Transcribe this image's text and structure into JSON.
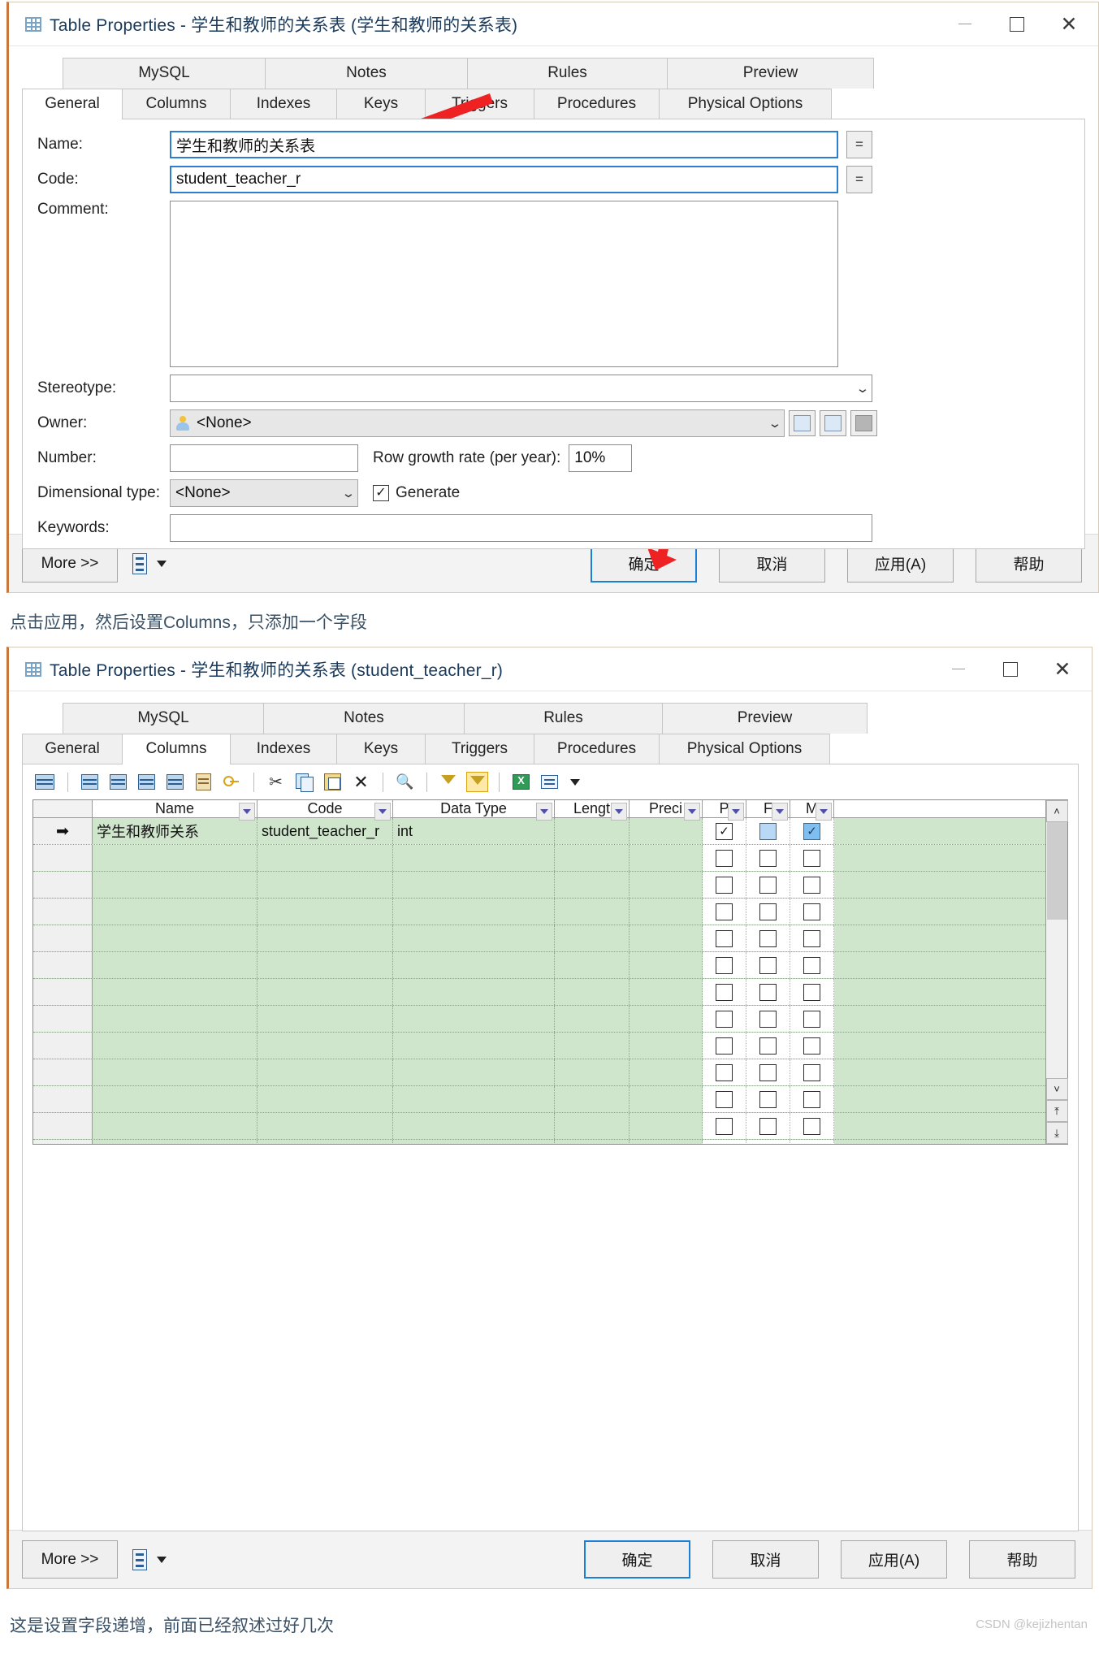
{
  "dialog1": {
    "title": "Table Properties - 学生和教师的关系表 (学生和教师的关系表)",
    "window_controls": {
      "minimize": "minimize-icon",
      "maximize": "maximize-icon",
      "close": "✕"
    },
    "tabs_row1": [
      "MySQL",
      "Notes",
      "Rules",
      "Preview"
    ],
    "tabs_row2": [
      "General",
      "Columns",
      "Indexes",
      "Keys",
      "Triggers",
      "Procedures",
      "Physical Options"
    ],
    "active_tab": "General",
    "form": {
      "name_label": "Name:",
      "name_value": "学生和教师的关系表",
      "code_label": "Code:",
      "code_value": "student_teacher_r",
      "eq_button": "=",
      "comment_label": "Comment:",
      "comment_value": "",
      "stereotype_label": "Stereotype:",
      "stereotype_value": "",
      "owner_label": "Owner:",
      "owner_value": "<None>",
      "number_label": "Number:",
      "number_value": "",
      "growth_label": "Row growth rate (per year):",
      "growth_value": "10%",
      "dimensional_label": "Dimensional type:",
      "dimensional_value": "<None>",
      "generate_label": "Generate",
      "generate_checked": true,
      "keywords_label": "Keywords:",
      "keywords_value": ""
    },
    "footer": {
      "more": "More >>",
      "ok": "确定",
      "cancel": "取消",
      "apply": "应用(A)",
      "help": "帮助"
    }
  },
  "note1": "点击应用，然后设置Columns，只添加一个字段",
  "dialog2": {
    "title": "Table Properties - 学生和教师的关系表 (student_teacher_r)",
    "window_controls": {
      "minimize": "minimize-icon",
      "maximize": "maximize-icon",
      "close": "✕"
    },
    "tabs_row1": [
      "MySQL",
      "Notes",
      "Rules",
      "Preview"
    ],
    "tabs_row2": [
      "General",
      "Columns",
      "Indexes",
      "Keys",
      "Triggers",
      "Procedures",
      "Physical Options"
    ],
    "active_tab": "Columns",
    "toolbar_icons": [
      "properties-icon",
      "insert-row-icon",
      "add-row-icon",
      "add-column-icon",
      "replace-column-icon",
      "notes-icon",
      "key-icon",
      "cut-icon",
      "copy-icon",
      "paste-icon",
      "delete-icon",
      "find-icon",
      "filter-icon",
      "filter-active-icon",
      "export-excel-icon",
      "print-icon",
      "print-dropdown-icon"
    ],
    "grid": {
      "headers": [
        "Name",
        "Code",
        "Data Type",
        "Lengt",
        "Preci",
        "P",
        "F",
        "M"
      ],
      "rows": [
        {
          "selector": "➡",
          "name": "学生和教师关系",
          "code": "student_teacher_r",
          "data_type": "int",
          "length": "",
          "precision": "",
          "p": true,
          "f": false,
          "m": true,
          "f_highlighted": true
        }
      ],
      "empty_row_count": 12
    },
    "footer": {
      "more": "More >>",
      "ok": "确定",
      "cancel": "取消",
      "apply": "应用(A)",
      "help": "帮助"
    }
  },
  "note2": "这是设置字段递增，前面已经叙述过好几次",
  "watermark": "CSDN @kejizhentan",
  "colors": {
    "accent_border": "#c8763a",
    "primary_button_border": "#1c7fd6",
    "grid_green": "#cfe6cd",
    "title_blue": "#1a3a5c",
    "note_blue": "#3b5166",
    "arrow_red": "#ee2222"
  }
}
